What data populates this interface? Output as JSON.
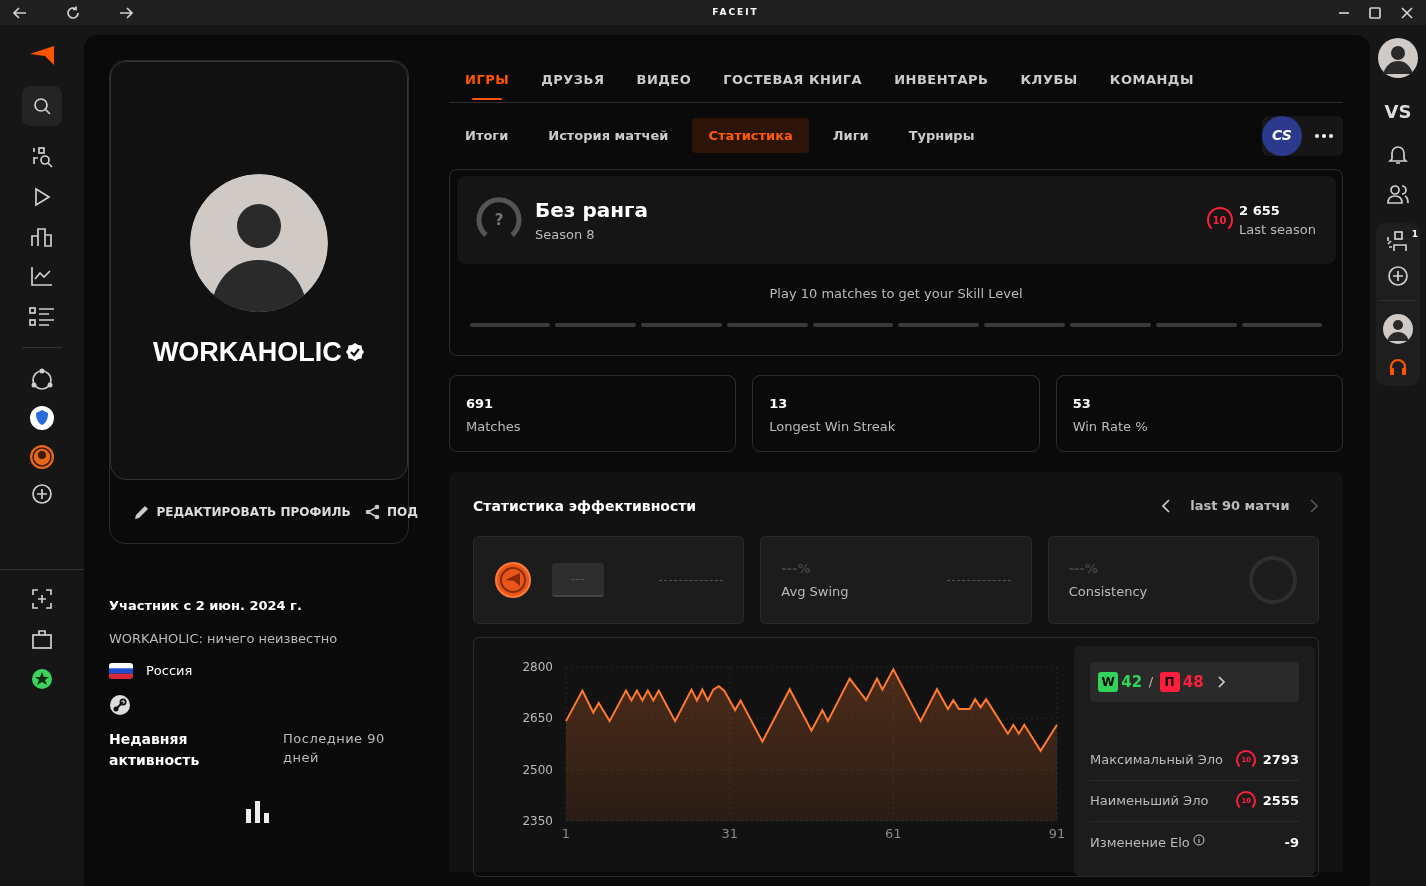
{
  "window": {
    "title": "FACEIT"
  },
  "profile": {
    "nickname": "WORKAHOLIC",
    "verified": true,
    "actions": [
      {
        "kind": "edit",
        "label": "РЕДАКТИРОВАТЬ ПРОФИЛЬ"
      },
      {
        "kind": "share",
        "label": "ПОД"
      }
    ],
    "member_since": "Участник с 2 июн. 2024 г.",
    "bio": "WORKAHOLIC: ничего неизвестно",
    "country": "Россия"
  },
  "recent_activity": {
    "title": "Недавняя активность",
    "period": "Последние 90 дней"
  },
  "tabs": [
    {
      "label": "ИГРЫ",
      "selected": true
    },
    {
      "label": "ДРУЗЬЯ",
      "selected": false
    },
    {
      "label": "ВИДЕО",
      "selected": false
    },
    {
      "label": "ГОСТЕВАЯ КНИГА",
      "selected": false
    },
    {
      "label": "ИНВЕНТАРЬ",
      "selected": false
    },
    {
      "label": "КЛУБЫ",
      "selected": false
    },
    {
      "label": "КОМАНДЫ",
      "selected": false
    }
  ],
  "subtabs": [
    {
      "label": "Итоги",
      "selected": false
    },
    {
      "label": "История матчей",
      "selected": false
    },
    {
      "label": "Статистика",
      "selected": true
    },
    {
      "label": "Лиги",
      "selected": false
    },
    {
      "label": "Турниры",
      "selected": false
    }
  ],
  "game_badge": "CS",
  "rank": {
    "unranked_mark": "?",
    "title": "Без ранга",
    "season": "Season 8",
    "last_level": "10",
    "last_elo": "2 655",
    "last_label": "Last season",
    "hint": "Play 10 matches to get your Skill Level"
  },
  "summary": [
    {
      "value": "691",
      "label": "Matches"
    },
    {
      "value": "13",
      "label": "Longest Win Streak"
    },
    {
      "value": "53",
      "label": "Win Rate %"
    }
  ],
  "performance": {
    "title": "Статистика эффективности",
    "range": "last 90 матчи",
    "cards": [
      {
        "kind": "rating",
        "value": "---"
      },
      {
        "kind": "swing",
        "value": "---%",
        "label": "Avg Swing"
      },
      {
        "kind": "consistency",
        "value": "---%",
        "label": "Consistency"
      }
    ],
    "chart_data": {
      "type": "area",
      "x": [
        1,
        4,
        6,
        7,
        9,
        12,
        13,
        14,
        15,
        16,
        17,
        18,
        21,
        24,
        25,
        26,
        27,
        28,
        29,
        30,
        32,
        33,
        37,
        42,
        46,
        48,
        49,
        53,
        56,
        58,
        59,
        61,
        66,
        69,
        71,
        72,
        73,
        75,
        76,
        77,
        78,
        82,
        83,
        84,
        85,
        88,
        91
      ],
      "series": [
        {
          "color": "#ff7a2f",
          "values": [
            2642,
            2731,
            2667,
            2695,
            2642,
            2731,
            2702,
            2731,
            2702,
            2731,
            2702,
            2731,
            2642,
            2734,
            2702,
            2734,
            2702,
            2734,
            2744,
            2731,
            2674,
            2702,
            2582,
            2735,
            2614,
            2674,
            2642,
            2766,
            2703,
            2766,
            2734,
            2793,
            2642,
            2735,
            2677,
            2703,
            2677,
            2677,
            2706,
            2682,
            2706,
            2605,
            2631,
            2605,
            2631,
            2555,
            2631
          ]
        }
      ],
      "grid": true,
      "xlim": [
        1,
        91
      ],
      "ylim": [
        2350,
        2800
      ],
      "xticks": [
        1,
        31,
        61,
        91
      ],
      "yticks": [
        2350,
        2500,
        2650,
        2800
      ]
    },
    "record_separator": "/",
    "record": [
      {
        "tag": "W",
        "count": "42",
        "color": "#32d35a"
      },
      {
        "tag": "П",
        "count": "48",
        "color": "#ff1f3d"
      }
    ],
    "elo_stats": [
      {
        "kind": "level",
        "label": "Максимальный Эло",
        "skill_level": "10",
        "value": "2793"
      },
      {
        "kind": "level",
        "label": "Наименьший Эло",
        "skill_level": "10",
        "value": "2555"
      },
      {
        "kind": "info",
        "label": "Изменение Elo",
        "value": "-9"
      }
    ]
  },
  "right_sidebar": {
    "vs": "VS",
    "party_count": "1"
  }
}
